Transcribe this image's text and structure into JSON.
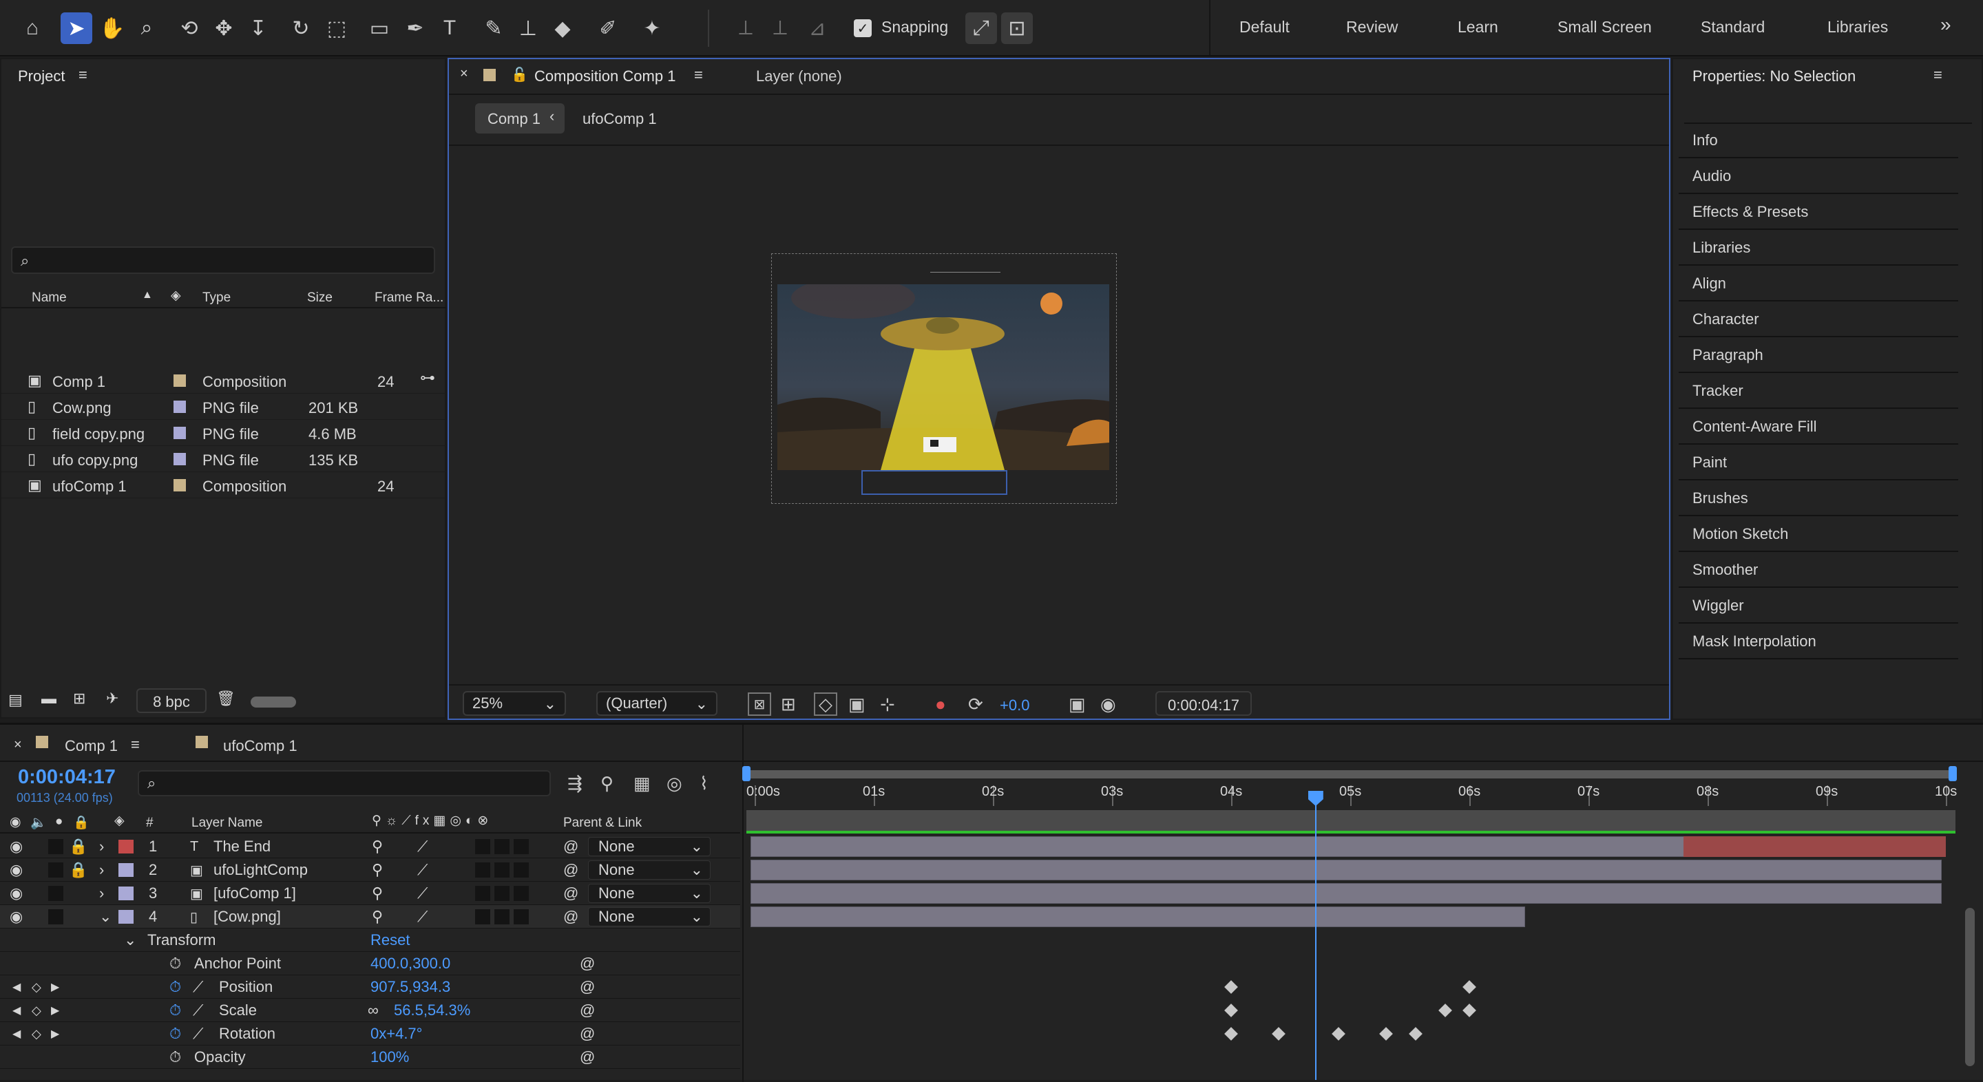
{
  "toolbar": {
    "snapping_label": "Snapping",
    "snapping_checked": true
  },
  "workspaces": [
    "Default",
    "Review",
    "Learn",
    "Small Screen",
    "Standard",
    "Libraries"
  ],
  "project": {
    "title": "Project",
    "search_placeholder": "",
    "columns": [
      "Name",
      "Type",
      "Size",
      "Frame Ra..."
    ],
    "items": [
      {
        "name": "Comp 1",
        "type": "Composition",
        "size": "",
        "fps": "24",
        "color": "#c9b48a",
        "icon": "composition-icon"
      },
      {
        "name": "Cow.png",
        "type": "PNG file",
        "size": "201 KB",
        "fps": "",
        "color": "#a9a9d6",
        "icon": "file-icon"
      },
      {
        "name": "field copy.png",
        "type": "PNG file",
        "size": "4.6 MB",
        "fps": "",
        "color": "#a9a9d6",
        "icon": "file-icon"
      },
      {
        "name": "ufo copy.png",
        "type": "PNG file",
        "size": "135 KB",
        "fps": "",
        "color": "#a9a9d6",
        "icon": "file-icon"
      },
      {
        "name": "ufoComp 1",
        "type": "Composition",
        "size": "",
        "fps": "24",
        "color": "#c9b48a",
        "icon": "composition-icon"
      }
    ],
    "bpc": "8 bpc"
  },
  "comp_viewer": {
    "tab_label": "Composition Comp 1",
    "layer_tab": "Layer (none)",
    "breadcrumb": [
      "Comp 1",
      "ufoComp 1"
    ],
    "zoom": "25%",
    "resolution": "(Quarter)",
    "exposure": "+0.0",
    "timecode": "0:00:04:17"
  },
  "properties": {
    "title": "Properties: No Selection",
    "items": [
      "Info",
      "Audio",
      "Effects & Presets",
      "Libraries",
      "Align",
      "Character",
      "Paragraph",
      "Tracker",
      "Content-Aware Fill",
      "Paint",
      "Brushes",
      "Motion Sketch",
      "Smoother",
      "Wiggler",
      "Mask Interpolation"
    ]
  },
  "timeline": {
    "tabs": [
      "Comp 1",
      "ufoComp 1"
    ],
    "timecode": "0:00:04:17",
    "frames": "00113 (24.00 fps)",
    "col_layer_name": "Layer Name",
    "col_parent": "Parent & Link",
    "col_num": "#",
    "ruler": [
      "0:00s",
      "01s",
      "02s",
      "03s",
      "04s",
      "05s",
      "06s",
      "07s",
      "08s",
      "09s",
      "10s"
    ],
    "layers": [
      {
        "num": "1",
        "name": "The End",
        "parent": "None",
        "color": "#c44a4a",
        "locked": true
      },
      {
        "num": "2",
        "name": "ufoLightComp",
        "parent": "None",
        "color": "#a9a9d6",
        "locked": true
      },
      {
        "num": "3",
        "name": "[ufoComp 1]",
        "parent": "None",
        "color": "#a9a9d6",
        "locked": false
      },
      {
        "num": "4",
        "name": "[Cow.png]",
        "parent": "None",
        "color": "#a9a9d6",
        "locked": false
      }
    ],
    "transform": {
      "label": "Transform",
      "reset": "Reset",
      "props": [
        {
          "name": "Anchor Point",
          "value": "400.0,300.0"
        },
        {
          "name": "Position",
          "value": "907.5,934.3"
        },
        {
          "name": "Scale",
          "value": "56.5,54.3%"
        },
        {
          "name": "Rotation",
          "value": "0x+4.7°"
        },
        {
          "name": "Opacity",
          "value": "100%"
        }
      ]
    },
    "playhead_seconds": 4.71,
    "duration_seconds": 10
  }
}
